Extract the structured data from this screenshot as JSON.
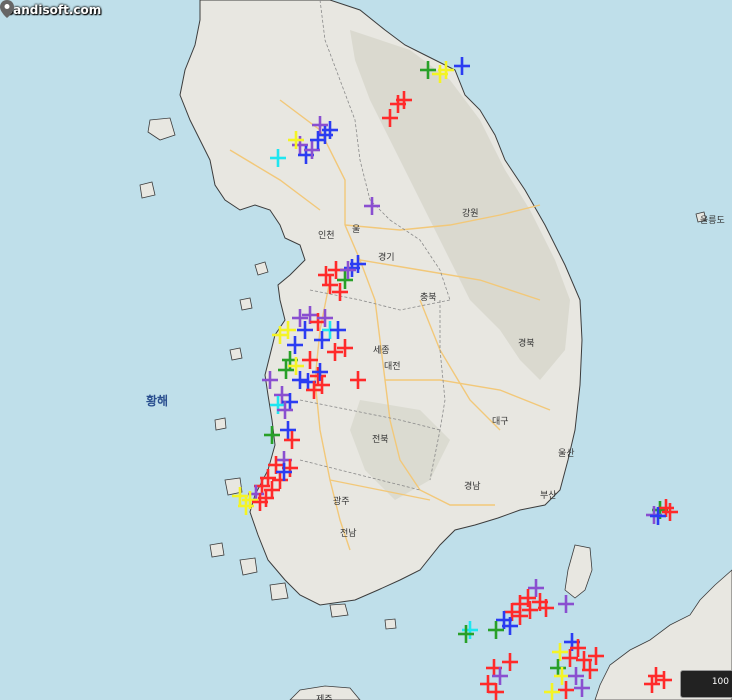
{
  "watermark": "Bandisoft.com",
  "labels": {
    "incheon": "인천",
    "seoul": "울",
    "gangwon": "강원",
    "gyeonggi": "경기",
    "chungbuk": "충북",
    "sejong": "세종",
    "daejeon": "대전",
    "gyeongbuk": "경북",
    "daegu": "대구",
    "ulsan": "울산",
    "jeonbuk": "전북",
    "gyeongnam": "경남",
    "busan": "부산",
    "gwangju": "광주",
    "jeonnam": "전남",
    "yellow_sea": "황해",
    "ulleungdo": "울릉도",
    "jeju": "제주"
  },
  "scale_label": "100",
  "colors": {
    "sea": "#bfdfea",
    "land": "#e8e7e1",
    "mountain": "#d9d9cf",
    "road": "#f2c879",
    "coast": "#3c3c3c",
    "strike_red": "#ff2a2a",
    "strike_blue": "#2b3cf2",
    "strike_purple": "#8a4fd0",
    "strike_cyan": "#1fe6f0",
    "strike_yellow": "#f4f424",
    "strike_green": "#28a028"
  },
  "legend_icons": {
    "location_pin": "map-pin-icon",
    "lightning_marker": "plus-cross-icon"
  }
}
